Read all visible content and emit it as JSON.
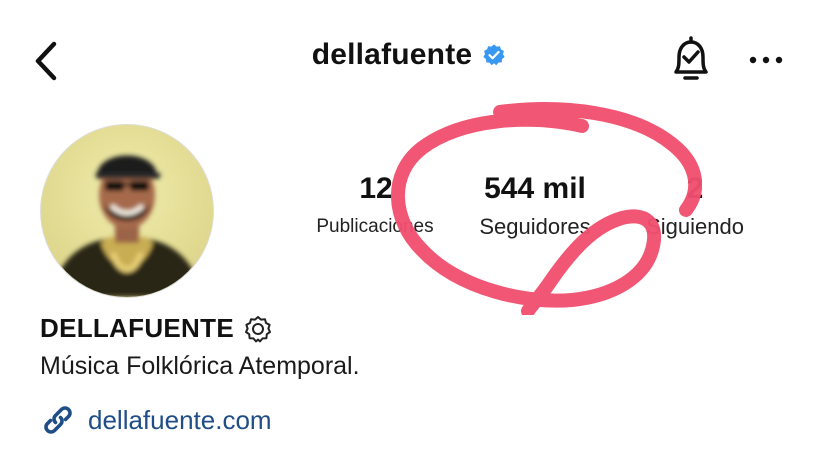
{
  "header": {
    "username": "dellafuente",
    "verified": true,
    "icons": [
      "chevron-left-icon",
      "verified-icon",
      "bell-check-icon",
      "more-horizontal-icon"
    ]
  },
  "stats": {
    "posts": {
      "value": "12",
      "label": "Publicaciones"
    },
    "followers": {
      "value": "544 mil",
      "label": "Seguidores"
    },
    "following": {
      "value": "2",
      "label": "Siguiendo"
    }
  },
  "profile": {
    "display_name": "DELLAFUENTE",
    "bio": "Música Folklórica Atemporal.",
    "link": "dellafuente.com",
    "link_icon": "link-icon",
    "badge_icon": "gear-badge-icon"
  },
  "colors": {
    "verified_blue": "#3897f0",
    "link_blue": "#1f4d86",
    "annotation_red": "#f0506e"
  }
}
